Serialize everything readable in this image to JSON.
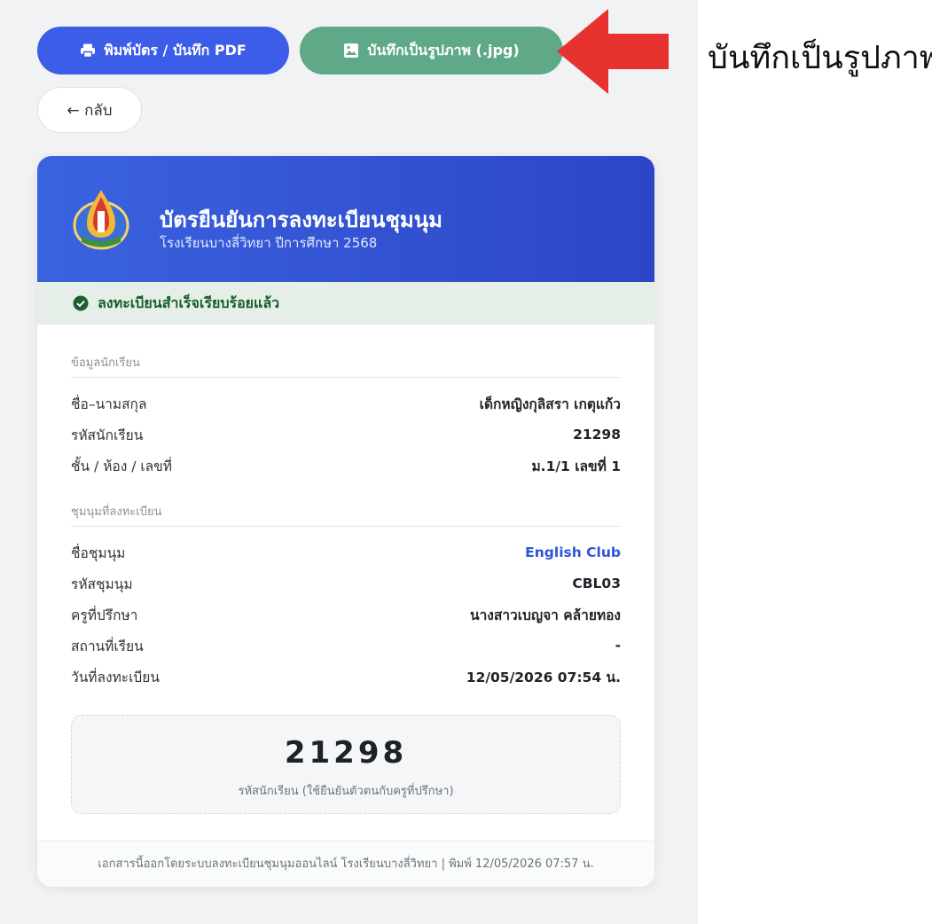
{
  "toolbar": {
    "print_label": "พิมพ์บัตร / บันทึก PDF",
    "save_image_label": "บันทึกเป็นรูปภาพ (.jpg)",
    "back_label": "← กลับ"
  },
  "annotation": {
    "caption": "บันทึกเป็นรูปภาพ",
    "arrow_color": "#e8322f"
  },
  "card": {
    "title": "บัตรยืนยันการลงทะเบียนชุมนุม",
    "subtitle": "โรงเรียนบางลี่วิทยา ปีการศึกษา 2568",
    "header_color": "#3a63e0",
    "status_text": "ลงทะเบียนสำเร็จเรียบร้อยแล้ว",
    "student_section": "ข้อมูลนักเรียน",
    "student_rows": [
      {
        "label": "ชื่อ–นามสกุล",
        "value": "เด็กหญิงกุลิสรา เกตุแก้ว"
      },
      {
        "label": "รหัสนักเรียน",
        "value": "21298"
      },
      {
        "label": "ชั้น / ห้อง / เลขที่",
        "value": "ม.1/1 เลขที่ 1"
      }
    ],
    "club_section": "ชุมนุมที่ลงทะเบียน",
    "club_rows": [
      {
        "label": "ชื่อชุมนุม",
        "value": "English Club"
      },
      {
        "label": "รหัสชุมนุม",
        "value": "CBL03"
      },
      {
        "label": "ครูที่ปรึกษา",
        "value": "นางสาวเบญจา คล้ายทอง"
      },
      {
        "label": "สถานที่เรียน",
        "value": "-"
      },
      {
        "label": "วันที่ลงทะเบียน",
        "value": "12/05/2026 07:54 น."
      }
    ],
    "student_id_big": "21298",
    "student_id_caption": "รหัสนักเรียน (ใช้ยืนยันตัวตนกับครูที่ปรึกษา)",
    "footer": "เอกสารนี้ออกโดยระบบลงทะเบียนชุมนุมออนไลน์ โรงเรียนบางลี่วิทยา | พิมพ์ 12/05/2026 07:57 น."
  }
}
